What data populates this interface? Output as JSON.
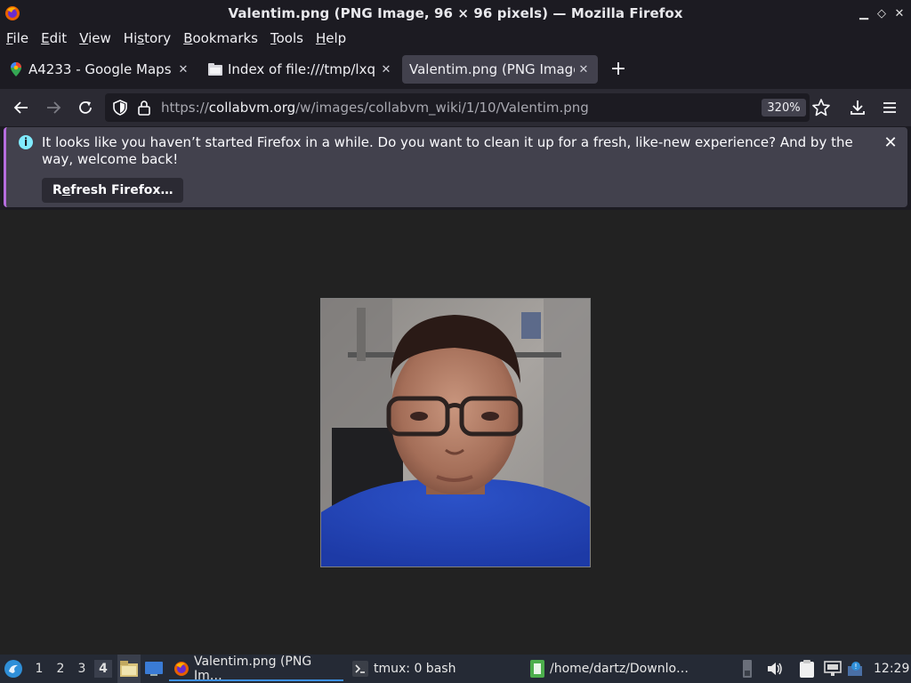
{
  "window": {
    "title": "Valentim.png (PNG Image, 96 × 96 pixels) — Mozilla Firefox"
  },
  "menu": {
    "items": [
      {
        "label": "File",
        "mnemonic": "F",
        "rest": "ile"
      },
      {
        "label": "Edit",
        "mnemonic": "E",
        "rest": "dit"
      },
      {
        "label": "View",
        "mnemonic": "V",
        "rest": "iew"
      },
      {
        "label": "History",
        "pre": "Hi",
        "mnemonic": "s",
        "rest": "tory"
      },
      {
        "label": "Bookmarks",
        "mnemonic": "B",
        "rest": "ookmarks"
      },
      {
        "label": "Tools",
        "mnemonic": "T",
        "rest": "ools"
      },
      {
        "label": "Help",
        "mnemonic": "H",
        "rest": "elp"
      }
    ]
  },
  "tabs": [
    {
      "label": "A4233 - Google Maps",
      "icon": "map-pin-icon"
    },
    {
      "label": "Index of file:///tmp/lxq",
      "icon": "folder-icon"
    },
    {
      "label": "Valentim.png (PNG Image",
      "icon": "none",
      "active": true
    }
  ],
  "navbar": {
    "url_prefix": "https://",
    "url_host": "collabvm.org",
    "url_path": "/w/images/collabvm_wiki/1/10/Valentim.png",
    "zoom": "320%"
  },
  "notification": {
    "message": "It looks like you haven’t started Firefox in a while. Do you want to clean it up for a fresh, like-new experience? And by the way, welcome back!",
    "button_pre": "R",
    "button_mnemonic": "e",
    "button_rest": "fresh Firefox…"
  },
  "taskbar": {
    "workspaces": [
      "1",
      "2",
      "3",
      "4"
    ],
    "active_workspace": "4",
    "tasks": [
      {
        "label": "Valentim.png (PNG Im…",
        "icon": "firefox-icon",
        "active": true
      },
      {
        "label": "tmux: 0 bash",
        "icon": "terminal-icon"
      },
      {
        "label": "/home/dartz/Downlo…",
        "icon": "file-manager-icon"
      }
    ],
    "clock": "12:29"
  },
  "colors": {
    "accent": "#3d8fe0",
    "notification_bar": "#b66dde",
    "info": "#80ebff"
  }
}
